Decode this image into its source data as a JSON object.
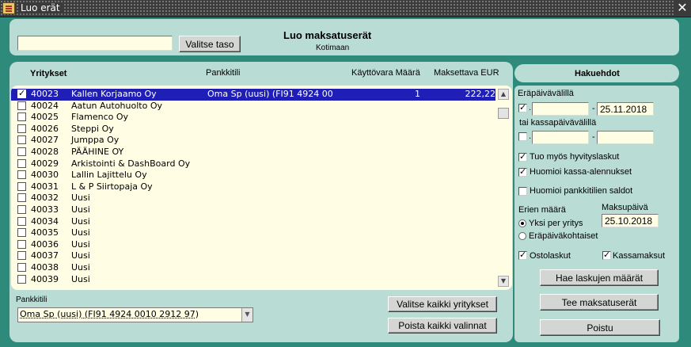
{
  "window": {
    "title": "Luo erät",
    "close_symbol": "✕"
  },
  "header": {
    "search_value": "",
    "select_level_button": "Valitse taso",
    "title": "Luo maksatuserät",
    "subtitle": "Kotimaan"
  },
  "columns": {
    "companies": "Yritykset",
    "bank_account": "Pankkitili",
    "reserve_amount": "Käyttövara Määrä",
    "payable_eur": "Maksettava EUR"
  },
  "rows": [
    {
      "checked": true,
      "code": "40023",
      "name": "Kallen Korjaamo Oy",
      "bank": "Oma Sp (uusi) (FI91 4924 00",
      "qty": "1",
      "amount": "222,22",
      "selected": true
    },
    {
      "checked": false,
      "code": "40024",
      "name": "Aatun Autohuolto Oy",
      "bank": "",
      "qty": "",
      "amount": "",
      "selected": false
    },
    {
      "checked": false,
      "code": "40025",
      "name": "Flamenco Oy",
      "bank": "",
      "qty": "",
      "amount": "",
      "selected": false
    },
    {
      "checked": false,
      "code": "40026",
      "name": "Steppi Oy",
      "bank": "",
      "qty": "",
      "amount": "",
      "selected": false
    },
    {
      "checked": false,
      "code": "40027",
      "name": "Jumppa Oy",
      "bank": "",
      "qty": "",
      "amount": "",
      "selected": false
    },
    {
      "checked": false,
      "code": "40028",
      "name": "PÄÄHINE OY",
      "bank": "",
      "qty": "",
      "amount": "",
      "selected": false
    },
    {
      "checked": false,
      "code": "40029",
      "name": "Arkistointi & DashBoard Oy",
      "bank": "",
      "qty": "",
      "amount": "",
      "selected": false
    },
    {
      "checked": false,
      "code": "40030",
      "name": "Lallin Lajittelu Oy",
      "bank": "",
      "qty": "",
      "amount": "",
      "selected": false
    },
    {
      "checked": false,
      "code": "40031",
      "name": "L & P Siirtopaja Oy",
      "bank": "",
      "qty": "",
      "amount": "",
      "selected": false
    },
    {
      "checked": false,
      "code": "40032",
      "name": "Uusi",
      "bank": "",
      "qty": "",
      "amount": "",
      "selected": false
    },
    {
      "checked": false,
      "code": "40033",
      "name": "Uusi",
      "bank": "",
      "qty": "",
      "amount": "",
      "selected": false
    },
    {
      "checked": false,
      "code": "40034",
      "name": "Uusi",
      "bank": "",
      "qty": "",
      "amount": "",
      "selected": false
    },
    {
      "checked": false,
      "code": "40035",
      "name": "Uusi",
      "bank": "",
      "qty": "",
      "amount": "",
      "selected": false
    },
    {
      "checked": false,
      "code": "40036",
      "name": "Uusi",
      "bank": "",
      "qty": "",
      "amount": "",
      "selected": false
    },
    {
      "checked": false,
      "code": "40037",
      "name": "Uusi",
      "bank": "",
      "qty": "",
      "amount": "",
      "selected": false
    },
    {
      "checked": false,
      "code": "40038",
      "name": "Uusi",
      "bank": "",
      "qty": "",
      "amount": "",
      "selected": false
    },
    {
      "checked": false,
      "code": "40039",
      "name": "Uusi",
      "bank": "",
      "qty": "",
      "amount": "",
      "selected": false
    }
  ],
  "bottom": {
    "bank_label": "Pankkitili",
    "bank_value": "Oma Sp (uusi) (FI91 4924 0010 2912 97)",
    "select_all_button": "Valitse kaikki yritykset",
    "clear_all_button": "Poista kaikki valinnat"
  },
  "criteria": {
    "header": "Hakuehdot",
    "due_date_label": "Eräpäivävälillä",
    "due_checked": true,
    "due_from": "",
    "due_to": "25.11.2018",
    "dash": "-",
    "dot": ".",
    "cash_date_label": "tai kassapäivävälillä",
    "cash_checked": false,
    "cash_from": "",
    "cash_to": "",
    "include_credit_label": "Tuo myös hyvityslaskut",
    "include_credit_checked": true,
    "cash_discount_label": "Huomioi kassa-alennukset",
    "cash_discount_checked": true,
    "bank_balances_label": "Huomioi pankkitilien saldot",
    "bank_balances_checked": false,
    "batch_count_label": "Erien määrä",
    "one_per_company_label": "Yksi per yritys",
    "per_due_date_label": "Eräpäiväkohtaiset",
    "one_per_company_selected": true,
    "payment_date_label": "Maksupäivä",
    "payment_date": "25.10.2018",
    "purchase_invoices_label": "Ostolaskut",
    "purchase_invoices_checked": true,
    "cash_payments_label": "Kassamaksut",
    "cash_payments_checked": true,
    "fetch_button": "Hae laskujen määrät",
    "create_button": "Tee maksatuserät",
    "exit_button": "Poistu"
  }
}
